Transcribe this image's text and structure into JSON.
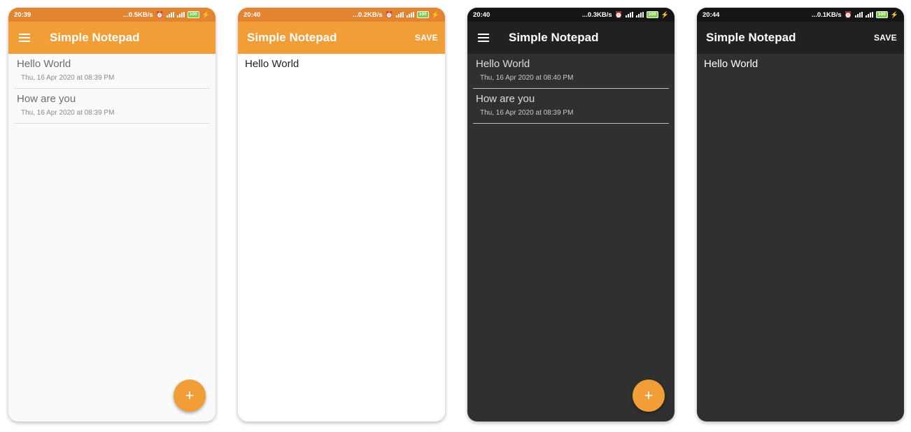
{
  "colors": {
    "accent": "#f19d38",
    "status_orange": "#e38431",
    "dark_background": "#303030",
    "dark_appbar": "#212121",
    "battery_green": "#7bcf45"
  },
  "phones": [
    {
      "status": {
        "time": "20:39",
        "speed": "...0.5KB/s",
        "battery": "100"
      },
      "appbar": {
        "title": "Simple Notepad",
        "menu_icon": "hamburger-menu-icon"
      },
      "notes": [
        {
          "title": "Hello World",
          "date": "Thu, 16 Apr 2020 at 08:39 PM"
        },
        {
          "title": "How are you",
          "date": "Thu, 16 Apr 2020 at 08:39 PM"
        }
      ],
      "fab": {
        "label": "+",
        "icon": "plus-icon"
      }
    },
    {
      "status": {
        "time": "20:40",
        "speed": "...0.2KB/s",
        "battery": "100"
      },
      "appbar": {
        "title": "Simple Notepad",
        "save_label": "SAVE"
      },
      "editor": {
        "text": "Hello World"
      }
    },
    {
      "status": {
        "time": "20:40",
        "speed": "...0.3KB/s",
        "battery": "100"
      },
      "appbar": {
        "title": "Simple Notepad",
        "menu_icon": "hamburger-menu-icon"
      },
      "notes": [
        {
          "title": "Hello World",
          "date": "Thu, 16 Apr 2020 at 08:40 PM"
        },
        {
          "title": "How are you",
          "date": "Thu, 16 Apr 2020 at 08:39 PM"
        }
      ],
      "fab": {
        "label": "+",
        "icon": "plus-icon"
      }
    },
    {
      "status": {
        "time": "20:44",
        "speed": "...0.1KB/s",
        "battery": "100"
      },
      "appbar": {
        "title": "Simple Notepad",
        "save_label": "SAVE"
      },
      "editor": {
        "text": "Hello World"
      }
    }
  ]
}
